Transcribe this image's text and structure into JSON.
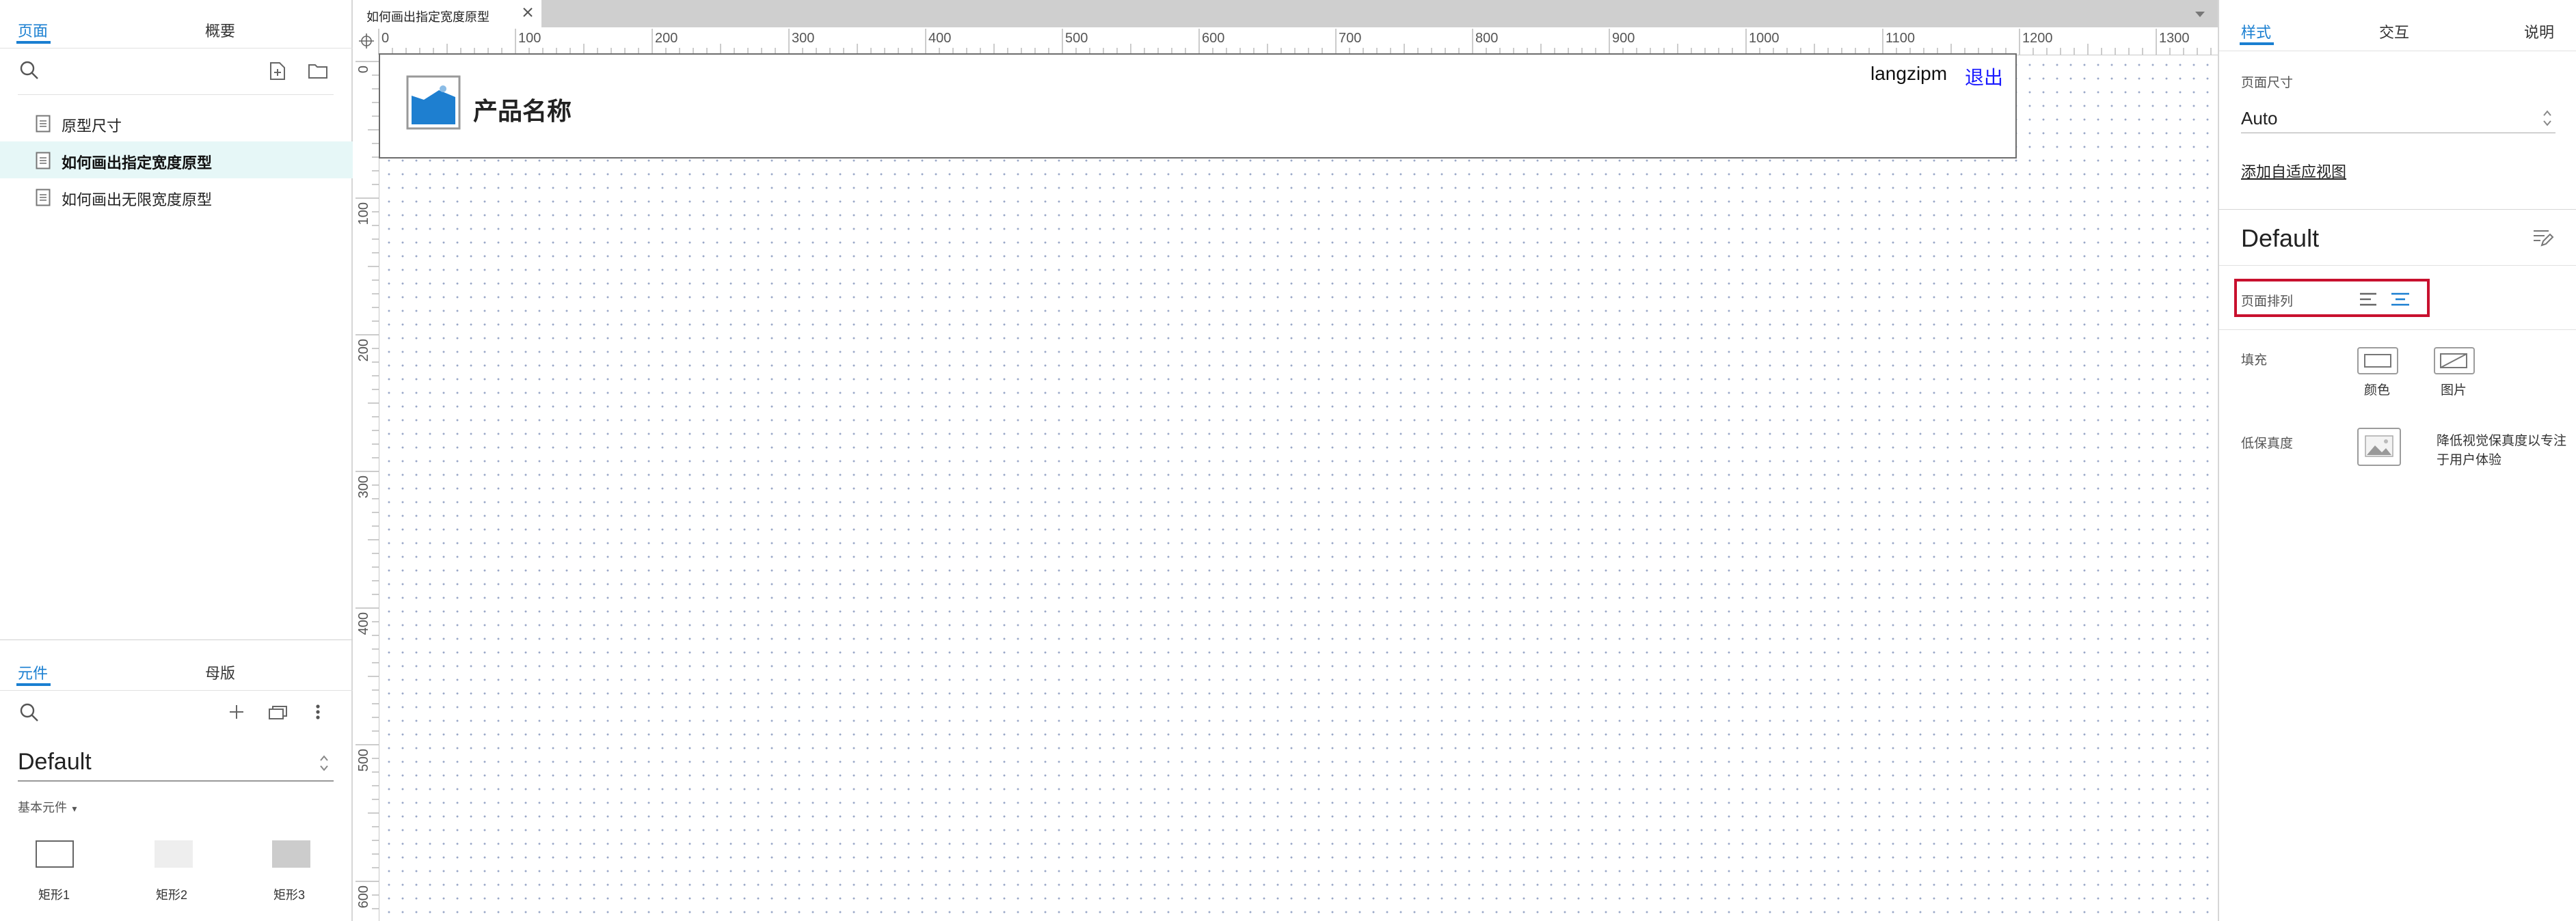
{
  "left_panel": {
    "tabs": [
      {
        "label": "页面",
        "active": true
      },
      {
        "label": "概要",
        "active": false
      }
    ],
    "pages": [
      {
        "label": "原型尺寸",
        "selected": false
      },
      {
        "label": "如何画出指定宽度原型",
        "selected": true
      },
      {
        "label": "如何画出无限宽度原型",
        "selected": false
      }
    ],
    "widget_tabs": [
      {
        "label": "元件",
        "active": true
      },
      {
        "label": "母版",
        "active": false
      }
    ],
    "library_name": "Default",
    "category": "基本元件",
    "widgets": [
      {
        "label": "矩形1",
        "fill": "#ffffff"
      },
      {
        "label": "矩形2",
        "fill": "#eeeeee"
      },
      {
        "label": "矩形3",
        "fill": "#cccccc"
      }
    ]
  },
  "canvas": {
    "tab_title": "如何画出指定宽度原型",
    "ruler_top_ticks": [
      "0",
      "100",
      "200",
      "300",
      "400",
      "500",
      "600",
      "700",
      "800",
      "900",
      "1000",
      "1100",
      "1200",
      "1300"
    ],
    "ruler_left_ticks": [
      "0",
      "100",
      "200",
      "300",
      "400",
      "500",
      "600"
    ],
    "header": {
      "product_name": "产品名称",
      "username": "langzipm",
      "logout": "退出"
    }
  },
  "right_panel": {
    "tabs": [
      {
        "label": "样式",
        "active": true
      },
      {
        "label": "交互",
        "active": false
      },
      {
        "label": "说明",
        "active": false
      }
    ],
    "page_size_label": "页面尺寸",
    "page_size_value": "Auto",
    "add_adaptive_view": "添加自适应视图",
    "style_name": "Default",
    "page_align_label": "页面排列",
    "fill_label": "填充",
    "fill_color_label": "颜色",
    "fill_image_label": "图片",
    "low_fidelity_label": "低保真度",
    "low_fidelity_desc": [
      "降低视觉保真度以专注",
      "于用户体验"
    ]
  },
  "colors": {
    "accent": "#1a7fd1",
    "selected_row": "#e6f7f7",
    "highlight_box": "#c8102e",
    "logout_link": "#1a1aff"
  }
}
